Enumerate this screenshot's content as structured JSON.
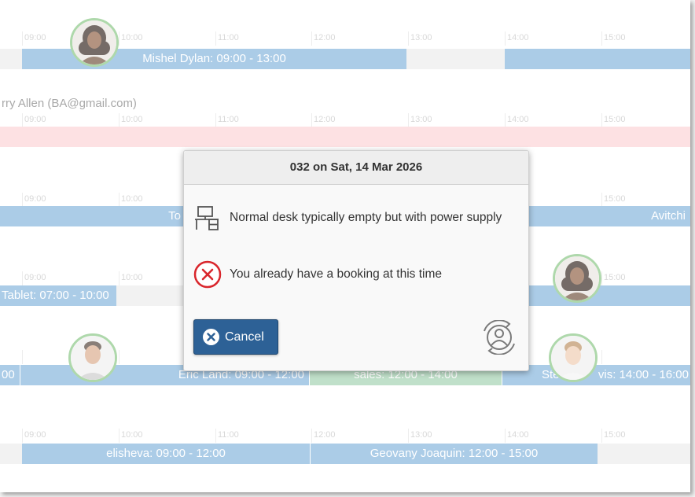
{
  "timeline": {
    "ticks": [
      "09:00",
      "10:00",
      "11:00",
      "12:00",
      "13:00",
      "14:00",
      "15:00"
    ],
    "rows": [
      {
        "label": "",
        "bookings": [
          "Mishel Dylan: 09:00 - 13:00"
        ]
      },
      {
        "label": "rry Allen (BA@gmail.com)",
        "bookings": []
      },
      {
        "label": "",
        "bookings": [
          "To",
          "Avitchi"
        ]
      },
      {
        "label": "",
        "bookings": [
          "Tablet: 07:00 - 10:00"
        ]
      },
      {
        "label": "",
        "bookings": [
          "00",
          "Eric Land: 09:00 - 12:00",
          "sales: 12:00 - 14:00",
          "Ste",
          "vis: 14:00 - 16:00"
        ]
      },
      {
        "label": "",
        "bookings": [
          "elisheva: 09:00 - 12:00",
          "Geovany Joaquin: 12:00 - 15:00"
        ]
      }
    ]
  },
  "dialog": {
    "title": "032 on Sat, 14 Mar 2026",
    "desk_description": "Normal desk typically empty but with power supply",
    "error_message": "You already have a booking at this time",
    "cancel_label": "Cancel",
    "icons": {
      "desk": "desk-icon",
      "error": "error-x-icon",
      "cancel": "close-icon",
      "switch_user": "switch-user-icon"
    }
  },
  "colors": {
    "booking": "#7fb1db",
    "unavailable": "#ebebeb",
    "blocked": "#fcd1d4",
    "group": "#9fcfae",
    "primary_button": "#2d6196",
    "error": "#d9262c",
    "avatar_ring": "#83c47f"
  }
}
